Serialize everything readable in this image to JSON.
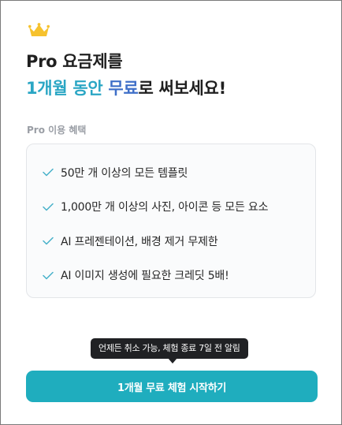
{
  "header": {
    "title_line1": "Pro 요금제를",
    "title_accent1": "1개월 동안",
    "title_accent2": "무료",
    "title_rest": "로 써보세요!"
  },
  "benefits": {
    "label": "Pro 이용 혜택",
    "items": [
      {
        "text": "50만 개 이상의 모든 템플릿",
        "icon": "check-icon"
      },
      {
        "text": "1,000만 개 이상의 사진, 아이콘 등 모든 요소",
        "icon": "check-icon"
      },
      {
        "text": "AI 프레젠테이션, 배경 제거 무제한",
        "icon": "check-icon"
      },
      {
        "text": "AI 이미지 생성에 필요한 크레딧 5배!",
        "icon": "check-icon"
      }
    ]
  },
  "tooltip": {
    "text": "언제든 취소 가능, 체험 종료 7일 전 알림"
  },
  "cta": {
    "label": "1개월 무료 체험 시작하기"
  },
  "icons": {
    "crown": "crown-icon"
  },
  "colors": {
    "accent_teal": "#2aa6c4",
    "accent_blue": "#3f6fc8",
    "crown": "#f6c22e",
    "check": "#46b1c9",
    "cta_bg": "#1fadbe",
    "tooltip_bg": "#202124"
  }
}
